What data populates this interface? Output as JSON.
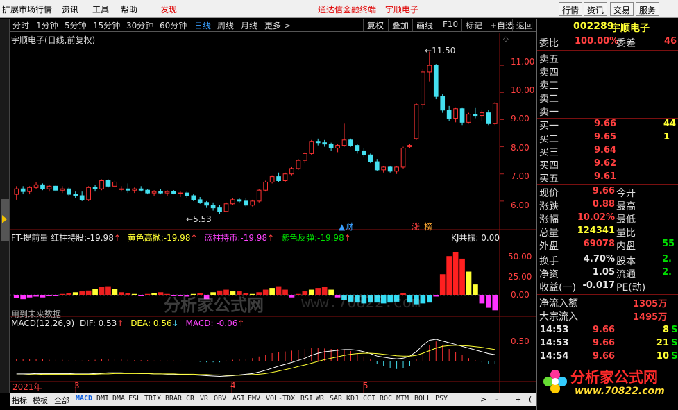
{
  "menu": {
    "items": [
      "扩展市场行情",
      "资讯",
      "工具",
      "帮助"
    ],
    "discover": "发现",
    "promo_terminal": "通达信金融终端",
    "promo_stock": "宇顺电子",
    "right_buttons": [
      "行情",
      "资讯",
      "交易",
      "服务"
    ],
    "window_buttons": [
      "_",
      "□",
      "×"
    ]
  },
  "period_bar": {
    "periods": [
      "分时",
      "1分钟",
      "5分钟",
      "15分钟",
      "30分钟",
      "60分钟",
      "日线",
      "周线",
      "月线",
      "更多 >"
    ],
    "active": "日线",
    "tools": [
      "复权",
      "叠加",
      "画线",
      "F10",
      "标记",
      "+自选",
      "返回"
    ]
  },
  "chart_title": "宇顺电子(日线,前复权)",
  "price_axis": [
    "11.00",
    "10.00",
    "9.00",
    "8.00",
    "7.00",
    "6.00"
  ],
  "annotations": {
    "high": "11.50",
    "low": "5.53",
    "cai": "财",
    "zhang": "涨",
    "bang": "榜"
  },
  "ft_indicator": {
    "name": "FT-提前量",
    "items": [
      {
        "label": "红柱持股:",
        "value": "-19.98",
        "color": "#ffffff"
      },
      {
        "label": "黄色高抛:",
        "value": "-19.98",
        "color": "#ffff33"
      },
      {
        "label": "蓝柱持币:",
        "value": "-19.98",
        "color": "#ff44ff"
      },
      {
        "label": "紫色反弹:",
        "value": "-19.98",
        "color": "#33ff33"
      }
    ],
    "kj": "KJ共振: 0.00",
    "axis": [
      "50.00",
      "25.00",
      "0.00"
    ],
    "note": "用到未来数据"
  },
  "macd": {
    "title": "MACD(12,26,9)",
    "dif": "DIF: 0.53",
    "dea": "DEA: 0.56",
    "macd": "MACD: -0.06",
    "axis": "0.50"
  },
  "date_axis": [
    "2021年",
    "3",
    "4",
    "5"
  ],
  "watermark": {
    "text": "分析家公式网",
    "url": "www.70822.com"
  },
  "bottom_tabs": {
    "labels": [
      "指标",
      "模板",
      "全部"
    ],
    "indicators": [
      "MACD",
      "DMI",
      "DMA",
      "FSL",
      "TRIX",
      "BRAR",
      "CR",
      "VR",
      "OBV",
      "ASI",
      "EMV",
      "VOL-TDX",
      "RSI",
      "WR",
      "SAR",
      "KDJ",
      "CCI",
      "ROC",
      "MTM",
      "BOLL",
      "PSY"
    ],
    "active": "MACD",
    "more": ">",
    "extra": [
      "-",
      "+",
      "("
    ]
  },
  "quote": {
    "code": "002289",
    "name": "宇顺电子",
    "weibi_label": "委比",
    "weibi": "100.00%",
    "weicha_label": "委差",
    "weicha": "46",
    "sells": [
      "卖五",
      "卖四",
      "卖三",
      "卖二",
      "卖一"
    ],
    "buys": [
      {
        "label": "买一",
        "price": "9.66",
        "vol": "44"
      },
      {
        "label": "买二",
        "price": "9.65",
        "vol": "1"
      },
      {
        "label": "买三",
        "price": "9.64",
        "vol": ""
      },
      {
        "label": "买四",
        "price": "9.62",
        "vol": ""
      },
      {
        "label": "买五",
        "price": "9.61",
        "vol": ""
      }
    ],
    "stats": [
      {
        "l1": "现价",
        "v1": "9.66",
        "c1": "red",
        "l2": "今开",
        "v2": ""
      },
      {
        "l1": "涨跌",
        "v1": "0.88",
        "c1": "red",
        "l2": "最高",
        "v2": ""
      },
      {
        "l1": "涨幅",
        "v1": "10.02%",
        "c1": "red",
        "l2": "最低",
        "v2": ""
      },
      {
        "l1": "总量",
        "v1": "124341",
        "c1": "yel",
        "l2": "量比",
        "v2": ""
      },
      {
        "l1": "外盘",
        "v1": "69078",
        "c1": "red",
        "l2": "内盘",
        "v2": "55"
      }
    ],
    "stats2": [
      {
        "l1": "换手",
        "v1": "4.70%",
        "c1": "wht",
        "l2": "股本",
        "v2": "2."
      },
      {
        "l1": "净资",
        "v1": "1.05",
        "c1": "wht",
        "l2": "流通",
        "v2": "2."
      },
      {
        "l1": "收益(一)",
        "v1": "-0.017",
        "c1": "wht",
        "l2": "PE(动)",
        "v2": ""
      }
    ],
    "flow": [
      {
        "label": "净流入额",
        "value": "1305万"
      },
      {
        "label": "大宗流入",
        "value": "1495万"
      }
    ],
    "ticks": [
      {
        "time": "14:53",
        "price": "9.66",
        "vol": "8",
        "dir": "S"
      },
      {
        "time": "14:53",
        "price": "9.66",
        "vol": "21",
        "dir": "S"
      },
      {
        "time": "14:54",
        "price": "9.66",
        "vol": "10",
        "dir": "S"
      }
    ],
    "daily_tab": "日线"
  },
  "ad": {
    "text": "分析家公式网",
    "url": "www.70822.com"
  },
  "chart_data": {
    "type": "candlestick",
    "ylim": [
      5.0,
      12.0
    ],
    "candles": [
      [
        6.25,
        6.55,
        6.05,
        6.45
      ],
      [
        6.45,
        6.55,
        6.25,
        6.35
      ],
      [
        6.35,
        6.55,
        6.25,
        6.5
      ],
      [
        6.5,
        6.7,
        6.45,
        6.6
      ],
      [
        6.6,
        6.65,
        6.4,
        6.45
      ],
      [
        6.45,
        6.6,
        6.35,
        6.55
      ],
      [
        6.55,
        6.6,
        6.35,
        6.4
      ],
      [
        6.4,
        6.55,
        6.3,
        6.45
      ],
      [
        6.45,
        6.5,
        6.2,
        6.25
      ],
      [
        6.25,
        6.35,
        6.1,
        6.2
      ],
      [
        6.2,
        6.35,
        6.0,
        6.05
      ],
      [
        6.05,
        6.55,
        6.0,
        6.5
      ],
      [
        6.5,
        6.6,
        6.35,
        6.45
      ],
      [
        6.45,
        6.8,
        6.4,
        6.75
      ],
      [
        6.75,
        6.8,
        6.5,
        6.55
      ],
      [
        6.55,
        6.75,
        6.5,
        6.7
      ],
      [
        6.45,
        6.55,
        6.35,
        6.45
      ],
      [
        6.45,
        6.65,
        6.3,
        6.4
      ],
      [
        6.4,
        6.5,
        6.3,
        6.45
      ],
      [
        6.45,
        6.55,
        6.35,
        6.4
      ],
      [
        6.4,
        6.45,
        6.25,
        6.3
      ],
      [
        6.3,
        6.4,
        6.2,
        6.35
      ],
      [
        6.35,
        6.45,
        6.25,
        6.3
      ],
      [
        6.3,
        6.4,
        6.2,
        6.35
      ],
      [
        6.35,
        6.4,
        6.25,
        6.28
      ],
      [
        6.28,
        6.35,
        6.15,
        6.3
      ],
      [
        6.3,
        6.35,
        6.1,
        6.2
      ],
      [
        6.2,
        6.25,
        6.0,
        6.05
      ],
      [
        6.05,
        6.15,
        5.9,
        5.95
      ],
      [
        5.95,
        6.0,
        5.75,
        5.85
      ],
      [
        5.85,
        5.95,
        5.65,
        5.75
      ],
      [
        5.75,
        5.85,
        5.53,
        5.62
      ],
      [
        5.62,
        5.95,
        5.6,
        5.9
      ],
      [
        5.9,
        6.1,
        5.85,
        6.05
      ],
      [
        6.05,
        6.1,
        5.95,
        6.0
      ],
      [
        6.0,
        6.1,
        5.8,
        5.85
      ],
      [
        5.85,
        6.05,
        5.8,
        6.0
      ],
      [
        6.0,
        6.45,
        5.95,
        6.4
      ],
      [
        6.4,
        6.75,
        6.35,
        6.7
      ],
      [
        6.7,
        6.95,
        6.65,
        6.9
      ],
      [
        6.9,
        7.05,
        6.7,
        6.75
      ],
      [
        6.75,
        7.05,
        6.7,
        7.0
      ],
      [
        7.0,
        7.25,
        6.95,
        7.2
      ],
      [
        7.2,
        7.55,
        7.15,
        7.5
      ],
      [
        7.5,
        7.8,
        7.4,
        7.75
      ],
      [
        7.75,
        8.25,
        7.7,
        8.2
      ],
      [
        8.2,
        8.3,
        8.05,
        8.15
      ],
      [
        8.15,
        8.25,
        8.0,
        8.1
      ],
      [
        8.1,
        8.15,
        7.85,
        7.95
      ],
      [
        7.95,
        8.1,
        7.8,
        8.05
      ],
      [
        8.05,
        8.85,
        8.0,
        8.25
      ],
      [
        8.25,
        8.3,
        8.0,
        8.05
      ],
      [
        8.05,
        8.1,
        7.75,
        7.85
      ],
      [
        7.85,
        7.95,
        7.6,
        7.7
      ],
      [
        7.7,
        7.75,
        7.4,
        7.45
      ],
      [
        7.45,
        7.55,
        7.1,
        7.15
      ],
      [
        7.15,
        7.3,
        7.05,
        7.25
      ],
      [
        7.25,
        7.3,
        7.05,
        7.1
      ],
      [
        7.1,
        7.3,
        7.0,
        7.25
      ],
      [
        7.25,
        8.0,
        7.2,
        7.95
      ],
      [
        8.0,
        8.1,
        7.95,
        8.05
      ],
      [
        8.3,
        9.6,
        8.25,
        9.55
      ],
      [
        9.55,
        10.85,
        9.4,
        10.75
      ],
      [
        10.75,
        11.5,
        10.4,
        11.0
      ],
      [
        11.0,
        11.05,
        9.75,
        9.85
      ],
      [
        9.85,
        9.95,
        9.25,
        9.35
      ],
      [
        9.35,
        9.5,
        8.95,
        9.05
      ],
      [
        9.05,
        9.45,
        8.9,
        9.4
      ],
      [
        9.4,
        9.45,
        8.8,
        8.9
      ],
      [
        8.9,
        9.25,
        8.85,
        9.2
      ],
      [
        9.2,
        9.45,
        9.05,
        9.15
      ],
      [
        9.15,
        9.35,
        8.95,
        9.25
      ],
      [
        9.25,
        9.35,
        8.8,
        8.85
      ],
      [
        8.85,
        9.65,
        8.8,
        9.6
      ]
    ],
    "ft_bars": [
      -4,
      -5,
      -3,
      -2,
      -3,
      -1,
      0,
      1,
      2,
      3,
      4,
      5,
      7,
      9,
      10,
      7,
      3,
      2,
      1,
      0,
      1,
      2,
      3,
      1,
      0,
      -1,
      -2,
      1,
      2,
      -5,
      3,
      5,
      6,
      4,
      4,
      2,
      1,
      3,
      6,
      8,
      10,
      6,
      -3,
      1,
      4,
      6,
      8,
      9,
      6,
      -3,
      -6,
      -8,
      -9,
      -10,
      -9,
      -9,
      -10,
      -9,
      -8,
      2,
      -9,
      -11,
      -10,
      -9,
      -2,
      24,
      45,
      50,
      42,
      27,
      12,
      -10,
      -15,
      -18,
      -22,
      -20,
      -10
    ],
    "macd_hist": [
      0.05,
      0.05,
      0.05,
      0.05,
      0.05,
      0.04,
      0.04,
      0.04,
      0.03,
      0.02,
      0.02,
      0.03,
      0.04,
      0.05,
      0.06,
      0.05,
      0.05,
      0.04,
      0.03,
      0.03,
      0.03,
      0.02,
      0.02,
      0.02,
      0.02,
      0.02,
      0.01,
      0.01,
      -0.01,
      -0.02,
      -0.02,
      -0.02,
      0.02,
      0.04,
      0.06,
      0.06,
      0.08,
      0.12,
      0.16,
      0.2,
      0.22,
      0.24,
      0.26,
      0.28,
      0.3,
      0.32,
      0.32,
      0.31,
      0.3,
      0.3,
      0.28,
      0.25,
      0.2,
      0.12,
      0.05,
      -0.05,
      -0.1,
      -0.15,
      -0.18,
      -0.15,
      -0.1,
      0.05,
      0.2,
      0.4,
      0.48,
      0.4,
      0.3,
      0.22,
      0.15,
      0.08,
      0.03,
      -0.02,
      -0.05,
      -0.06
    ],
    "dif": [
      0.08,
      0.08,
      0.08,
      0.09,
      0.09,
      0.09,
      0.09,
      0.09,
      0.09,
      0.08,
      0.08,
      0.08,
      0.09,
      0.1,
      0.11,
      0.11,
      0.11,
      0.1,
      0.1,
      0.09,
      0.09,
      0.08,
      0.08,
      0.07,
      0.07,
      0.06,
      0.06,
      0.05,
      0.04,
      0.03,
      0.02,
      0.01,
      0.02,
      0.03,
      0.05,
      0.07,
      0.09,
      0.13,
      0.18,
      0.24,
      0.3,
      0.35,
      0.4,
      0.46,
      0.52,
      0.6,
      0.66,
      0.7,
      0.72,
      0.74,
      0.76,
      0.76,
      0.74,
      0.7,
      0.65,
      0.58,
      0.55,
      0.52,
      0.5,
      0.52,
      0.58,
      0.7,
      0.88,
      1.02,
      1.05,
      1.0,
      0.95,
      0.9,
      0.85,
      0.8,
      0.75,
      0.7,
      0.65,
      0.62
    ],
    "dea": [
      0.05,
      0.05,
      0.06,
      0.06,
      0.07,
      0.07,
      0.07,
      0.07,
      0.07,
      0.07,
      0.07,
      0.07,
      0.07,
      0.08,
      0.08,
      0.09,
      0.09,
      0.09,
      0.09,
      0.09,
      0.09,
      0.08,
      0.08,
      0.08,
      0.08,
      0.07,
      0.07,
      0.07,
      0.06,
      0.06,
      0.05,
      0.05,
      0.04,
      0.04,
      0.04,
      0.05,
      0.06,
      0.07,
      0.09,
      0.12,
      0.16,
      0.2,
      0.24,
      0.29,
      0.33,
      0.38,
      0.43,
      0.48,
      0.52,
      0.56,
      0.6,
      0.63,
      0.65,
      0.66,
      0.66,
      0.65,
      0.63,
      0.61,
      0.59,
      0.58,
      0.58,
      0.6,
      0.66,
      0.73,
      0.8,
      0.85,
      0.87,
      0.88,
      0.87,
      0.86,
      0.84,
      0.82,
      0.79,
      0.76
    ]
  }
}
